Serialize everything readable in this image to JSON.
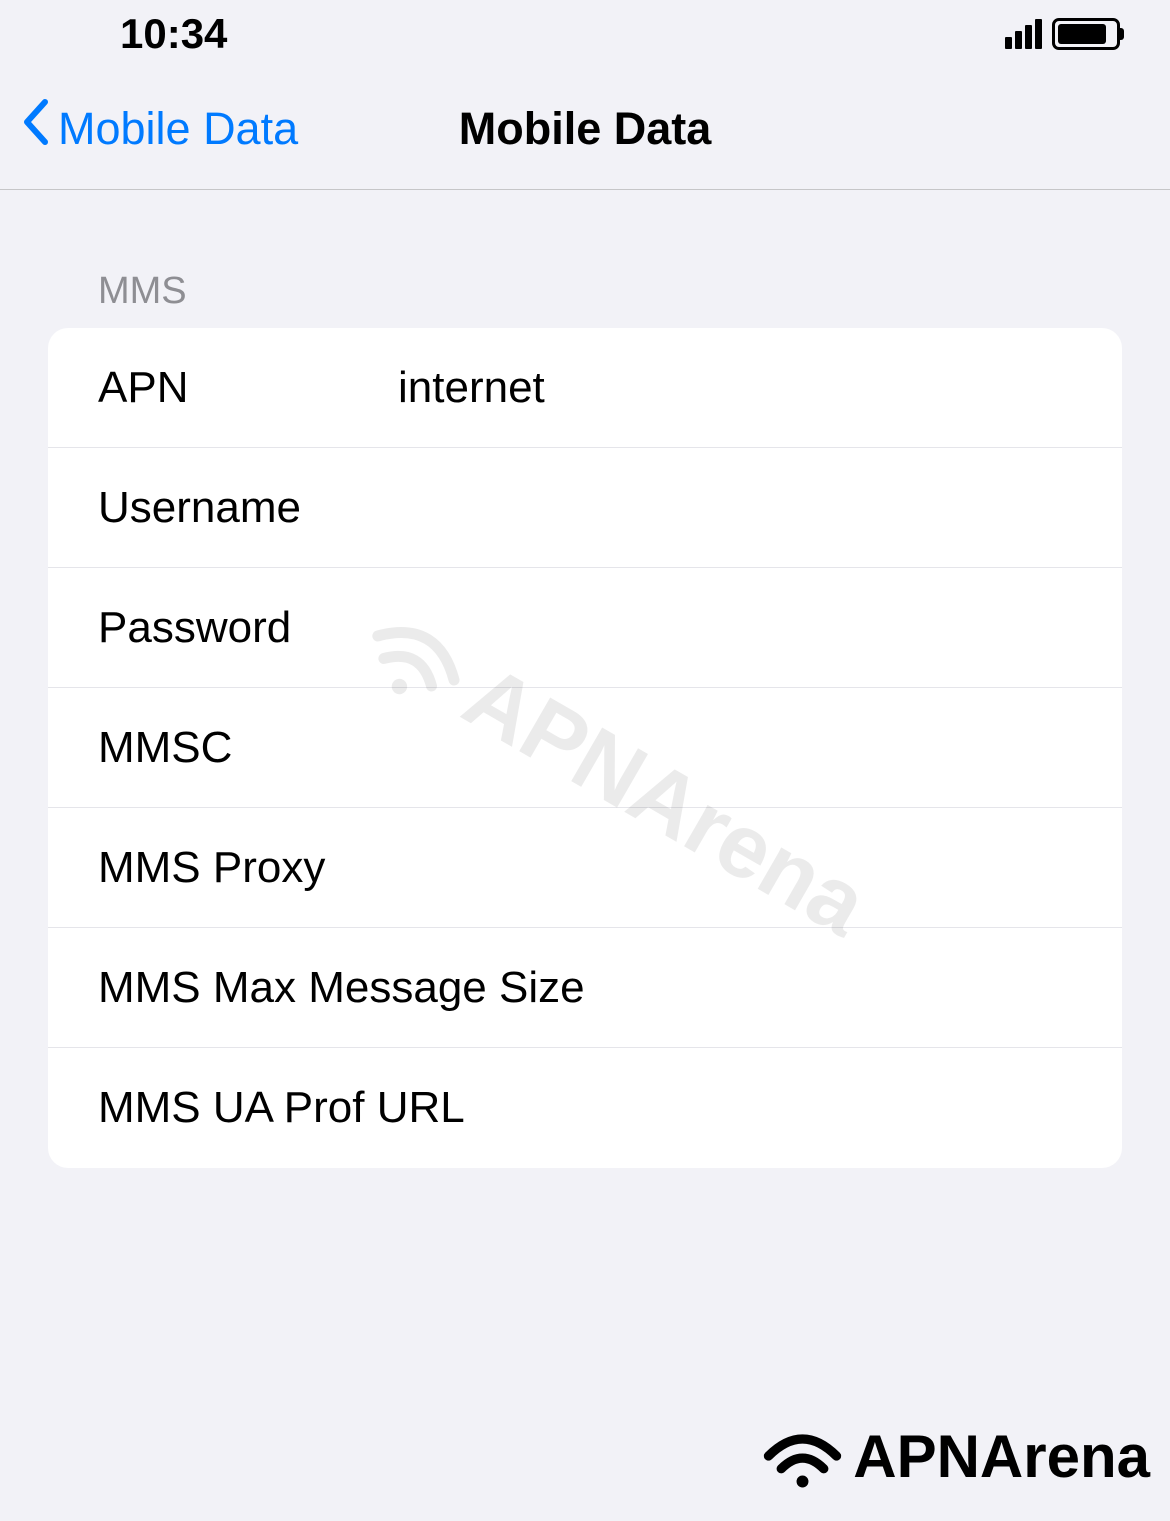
{
  "statusBar": {
    "time": "10:34"
  },
  "navBar": {
    "backLabel": "Mobile Data",
    "title": "Mobile Data"
  },
  "section": {
    "header": "MMS",
    "rows": [
      {
        "label": "APN",
        "value": "internet"
      },
      {
        "label": "Username",
        "value": ""
      },
      {
        "label": "Password",
        "value": ""
      },
      {
        "label": "MMSC",
        "value": ""
      },
      {
        "label": "MMS Proxy",
        "value": ""
      },
      {
        "label": "MMS Max Message Size",
        "value": ""
      },
      {
        "label": "MMS UA Prof URL",
        "value": ""
      }
    ]
  },
  "watermark": "APNArena",
  "footerBrand": "APNArena"
}
